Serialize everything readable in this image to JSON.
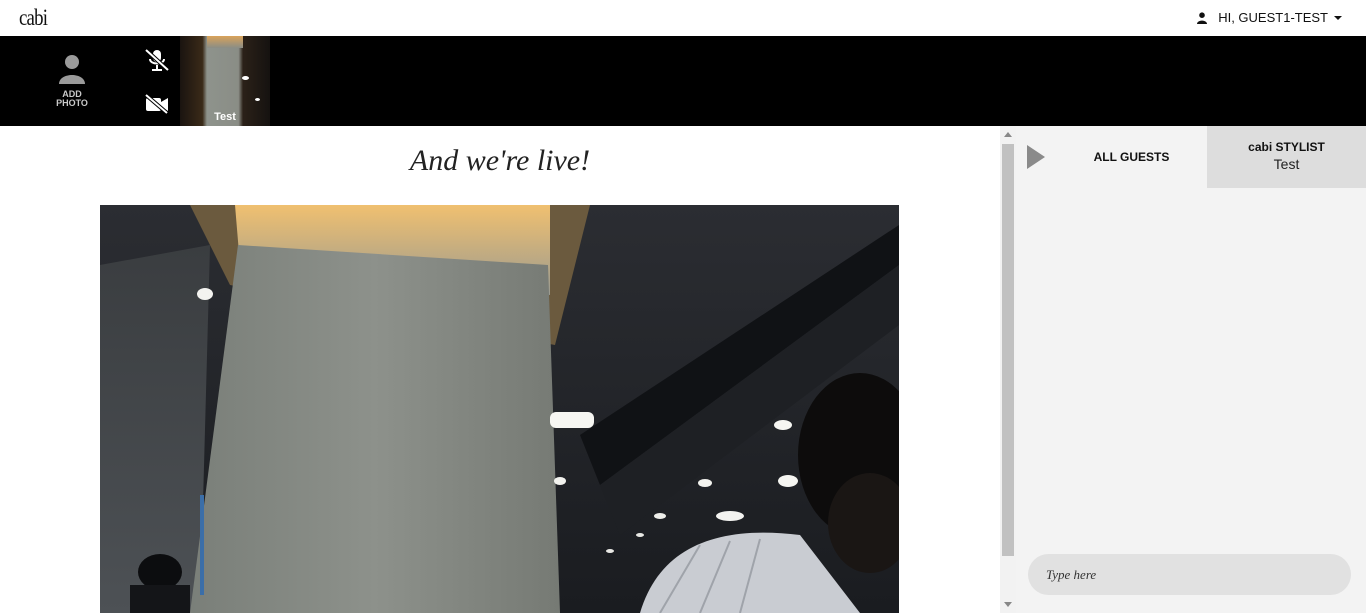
{
  "header": {
    "logo_text": "cabi",
    "greeting": "HI, GUEST1-TEST",
    "icons": [
      "user-icon",
      "caret-down-icon"
    ]
  },
  "media_strip": {
    "add_photo_label_line1": "ADD",
    "add_photo_label_line2": "PHOTO",
    "mic_state": "muted",
    "camera_state": "off",
    "thumbnail_name": "Test",
    "icons": [
      "avatar-placeholder-icon",
      "mic-muted-icon",
      "camera-off-icon"
    ]
  },
  "main": {
    "headline": "And we're live!"
  },
  "chat": {
    "tab_all_label": "ALL GUESTS",
    "tab_stylist_line1": "cabi STYLIST",
    "tab_stylist_line2": "Test",
    "input_placeholder": "Type here",
    "icons": [
      "collapse-arrow-icon"
    ]
  },
  "colors": {
    "strip_background": "#000000",
    "chat_background": "#f3f3f3",
    "stylist_tab_background": "#dddddd"
  }
}
